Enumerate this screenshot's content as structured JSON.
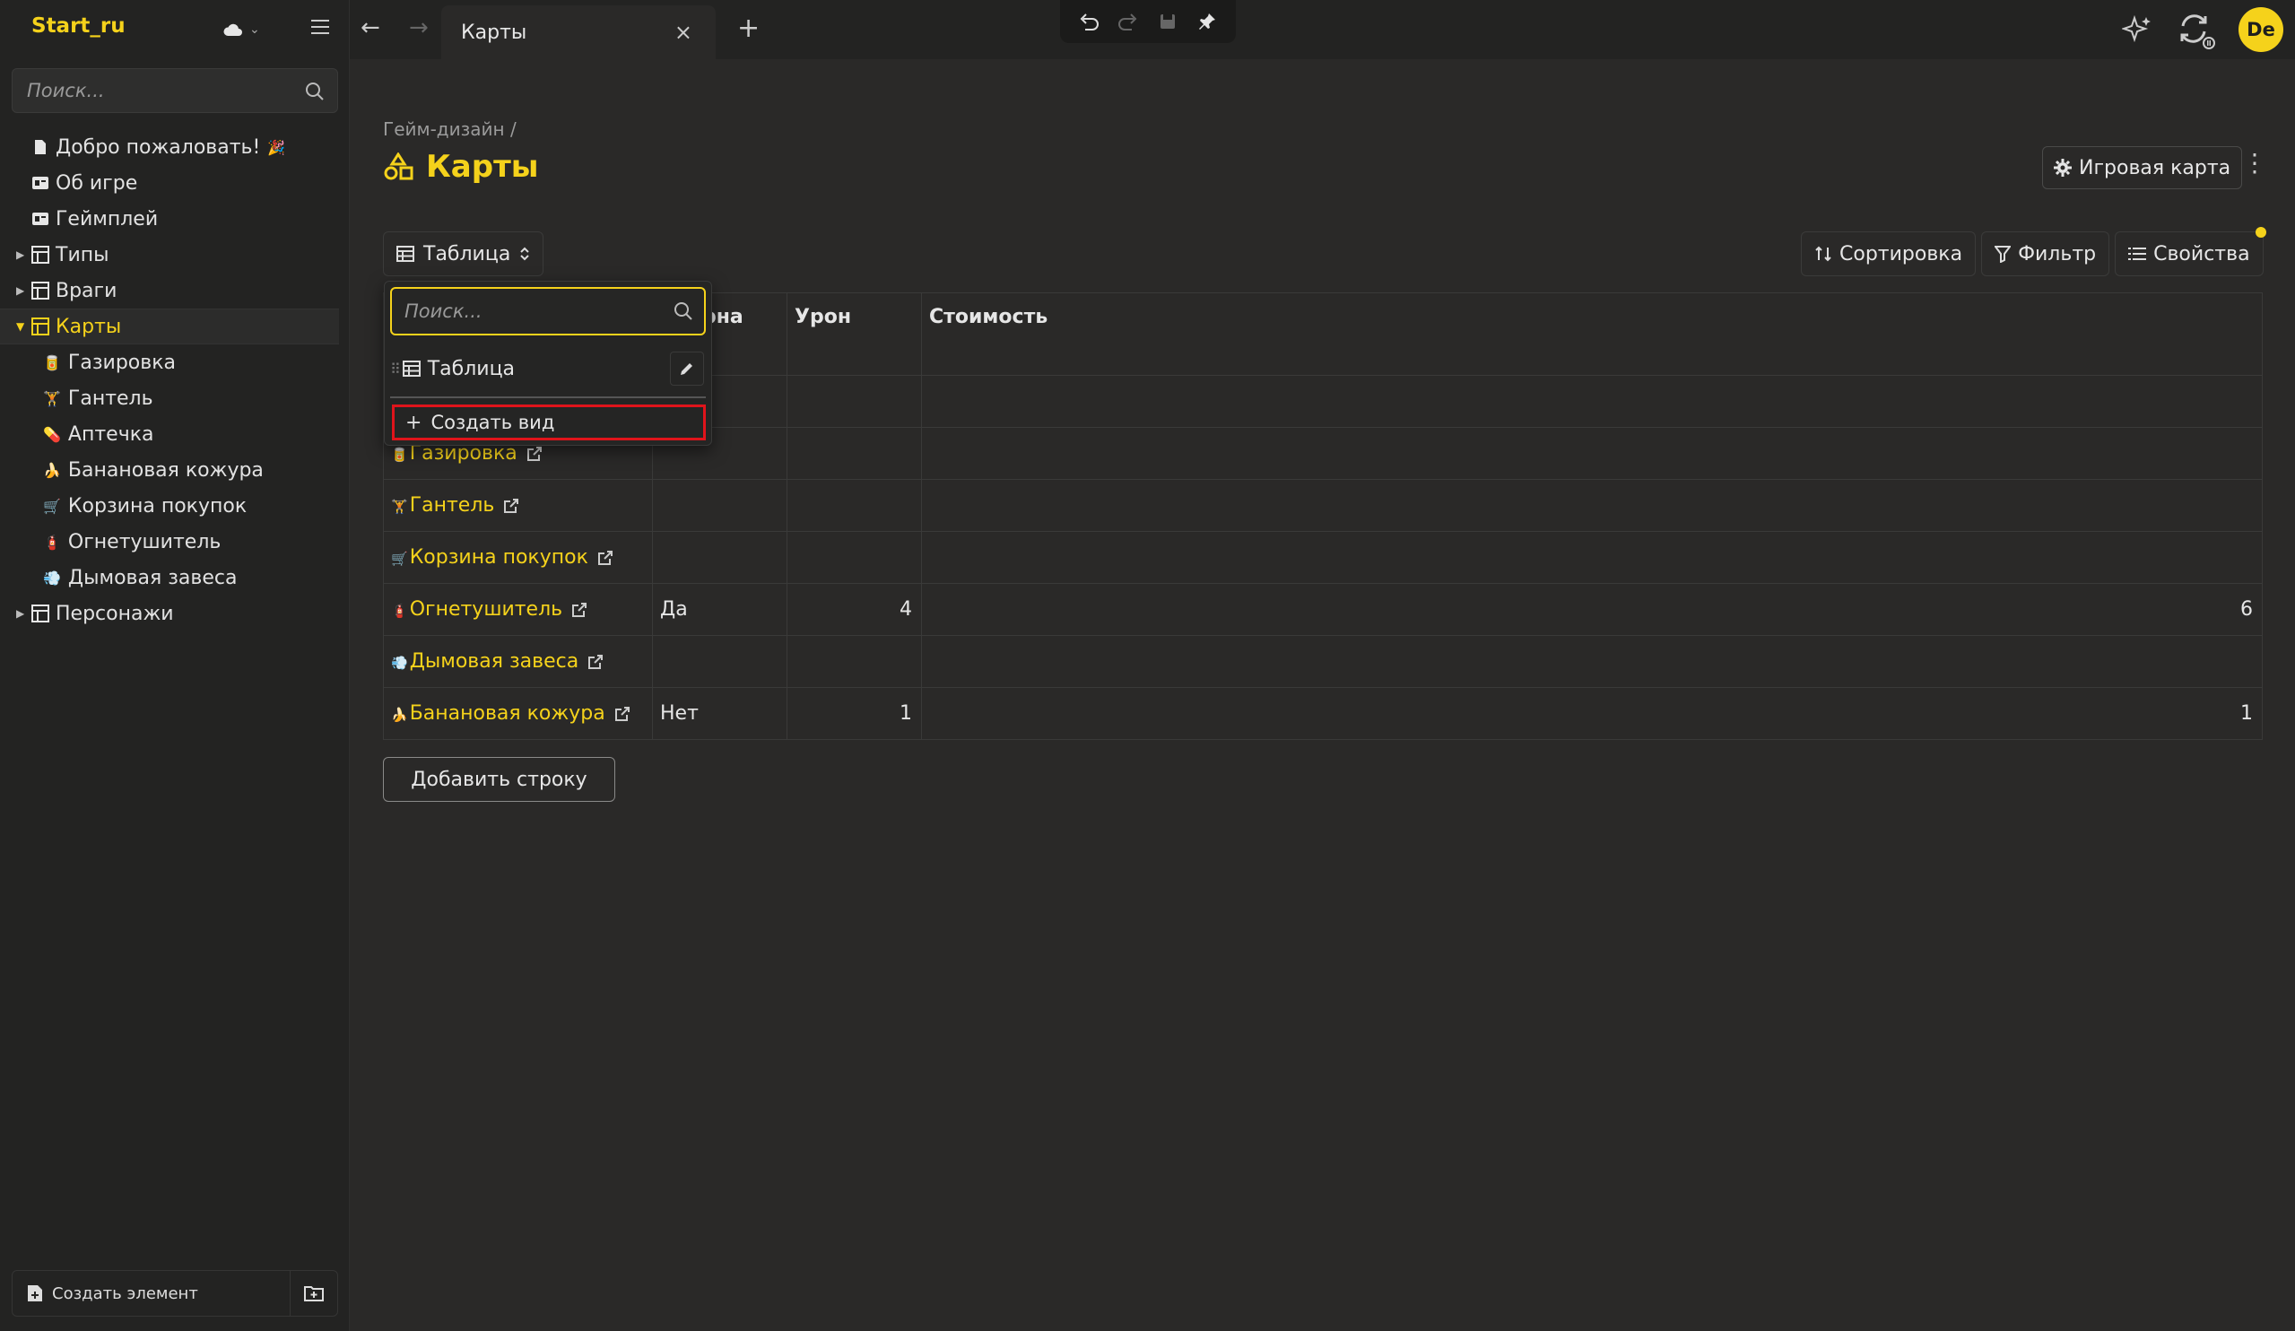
{
  "workspace": {
    "name": "Start_ru"
  },
  "sidebar": {
    "search_placeholder": "Поиск...",
    "items": [
      {
        "label": "Добро пожаловать!",
        "emoji": "🎉",
        "icon": "document-icon",
        "level": 0
      },
      {
        "label": "Об игре",
        "icon": "text-block-icon",
        "level": 0
      },
      {
        "label": "Геймплей",
        "icon": "text-block-icon",
        "level": 0
      },
      {
        "label": "Типы",
        "icon": "database-icon",
        "level": 0,
        "collapsed": true
      },
      {
        "label": "Враги",
        "icon": "database-icon",
        "level": 0,
        "collapsed": true
      },
      {
        "label": "Карты",
        "icon": "database-icon",
        "level": 0,
        "expanded": true,
        "active": true
      },
      {
        "label": "Газировка",
        "emoji": "🥫",
        "level": 1
      },
      {
        "label": "Гантель",
        "emoji": "🏋",
        "level": 1
      },
      {
        "label": "Аптечка",
        "emoji": "💊",
        "level": 1
      },
      {
        "label": "Банановая кожура",
        "emoji": "🍌",
        "level": 1
      },
      {
        "label": "Корзина покупок",
        "emoji": "🛒",
        "level": 1
      },
      {
        "label": "Огнетушитель",
        "emoji": "🧯",
        "level": 1
      },
      {
        "label": "Дымовая завеса",
        "emoji": "💨",
        "level": 1
      },
      {
        "label": "Персонажи",
        "icon": "database-icon",
        "level": 0,
        "collapsed": true
      }
    ],
    "footer": {
      "create_label": "Создать элемент"
    }
  },
  "tabbar": {
    "tab_label": "Карты"
  },
  "main": {
    "breadcrumb": "Гейм-дизайн /",
    "title": "Карты",
    "game_map_label": "Игровая карта",
    "view_label": "Таблица",
    "actions": {
      "sort": "Сортировка",
      "filter": "Фильтр",
      "props": "Свойства"
    },
    "table": {
      "columns": [
        "",
        "ударна",
        "Урон",
        "Стоимость"
      ],
      "rows": [
        {
          "name": "",
          "emoji": "",
          "col2": "",
          "col3": "",
          "col4": "",
          "link": false
        },
        {
          "name": "Газировка",
          "emoji": "🥫",
          "col2": "",
          "col3": "",
          "col4": "",
          "link": true
        },
        {
          "name": "Гантель",
          "emoji": "🏋",
          "col2": "",
          "col3": "",
          "col4": "",
          "link": true
        },
        {
          "name": "Корзина покупок",
          "emoji": "🛒",
          "col2": "",
          "col3": "",
          "col4": "",
          "link": true
        },
        {
          "name": "Огнетушитель",
          "emoji": "🧯",
          "col2": "Да",
          "col3": "4",
          "col4": "6",
          "link": true
        },
        {
          "name": "Дымовая завеса",
          "emoji": "💨",
          "col2": "",
          "col3": "",
          "col4": "",
          "link": true
        },
        {
          "name": "Банановая кожура",
          "emoji": "🍌",
          "col2": "Нет",
          "col3": "1",
          "col4": "1",
          "link": true
        }
      ]
    },
    "add_row_label": "Добавить строку"
  },
  "dropdown": {
    "search_placeholder": "Поиск...",
    "view_item": "Таблица",
    "create_view": "Создать вид"
  },
  "user": {
    "initials": "De"
  },
  "colors": {
    "accent": "#f5d21b",
    "highlight": "#e0141b",
    "bg": "#2a2928",
    "sidebar": "#232322"
  }
}
